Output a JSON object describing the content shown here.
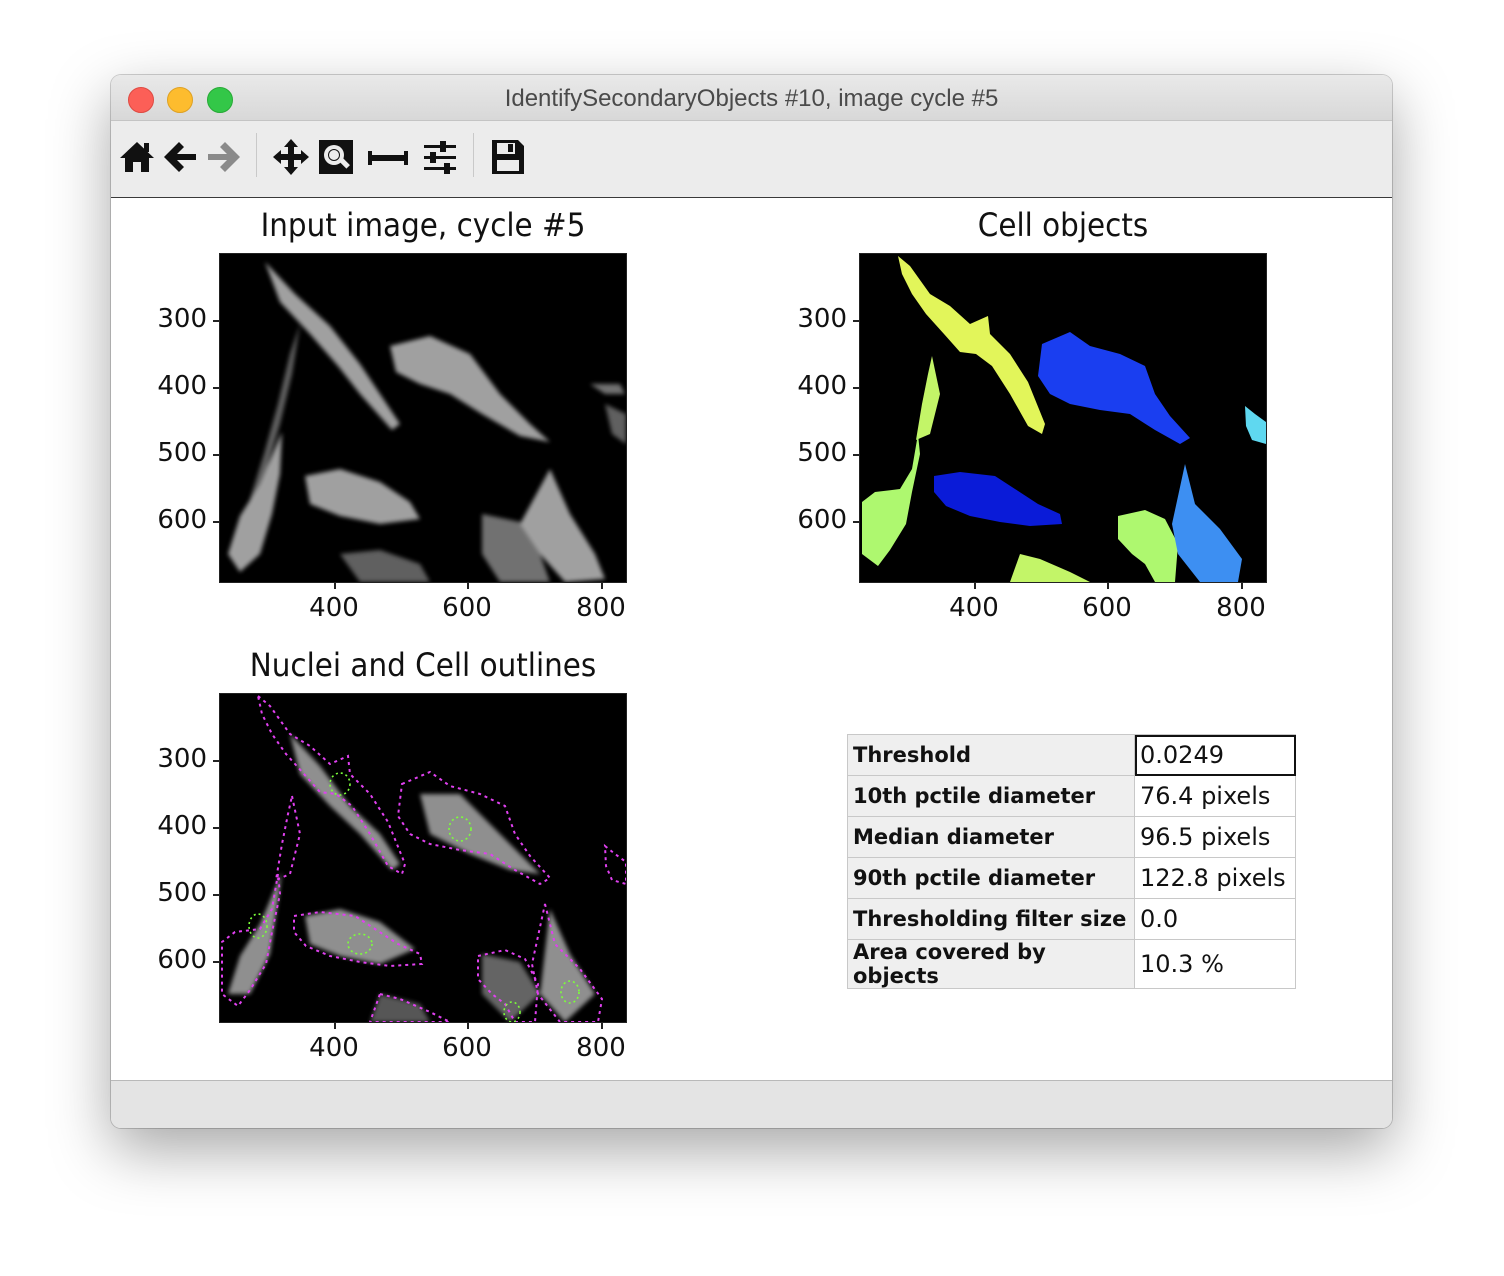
{
  "window": {
    "title": "IdentifySecondaryObjects #10, image cycle #5"
  },
  "toolbar": {
    "icons": [
      "home-icon",
      "back-icon",
      "forward-icon",
      "pan-icon",
      "zoom-icon",
      "subplots-icon",
      "configure-icon",
      "save-icon"
    ]
  },
  "plots": {
    "input": {
      "title": "Input image, cycle #5",
      "yticks": [
        "300",
        "400",
        "500",
        "600"
      ],
      "xticks": [
        "400",
        "600",
        "800"
      ]
    },
    "objects": {
      "title": "Cell objects",
      "yticks": [
        "300",
        "400",
        "500",
        "600"
      ],
      "xticks": [
        "400",
        "600",
        "800"
      ],
      "colors": [
        "#e2f55a",
        "#1a3ef0",
        "#0a1bd8",
        "#aef86f",
        "#3d8ff2",
        "#5fd8f0",
        "#c3f568"
      ]
    },
    "outlines": {
      "title": "Nuclei and Cell outlines",
      "yticks": [
        "300",
        "400",
        "500",
        "600"
      ],
      "xticks": [
        "400",
        "600",
        "800"
      ],
      "colors": {
        "cell_outline": "#e040f0",
        "nucleus_outline": "#7cff3a"
      }
    }
  },
  "stats": [
    {
      "label": "Threshold",
      "value": "0.0249"
    },
    {
      "label": "10th pctile diameter",
      "value": "76.4 pixels"
    },
    {
      "label": "Median diameter",
      "value": "96.5 pixels"
    },
    {
      "label": "90th pctile diameter",
      "value": "122.8 pixels"
    },
    {
      "label": "Thresholding filter size",
      "value": "0.0"
    },
    {
      "label": "Area covered by objects",
      "value": "10.3 %"
    }
  ]
}
